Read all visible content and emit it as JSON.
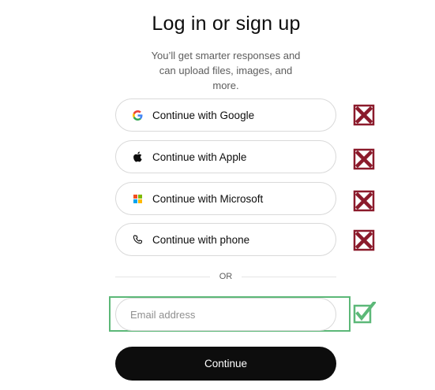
{
  "header": {
    "title": "Log in or sign up",
    "subtitle": "You’ll get smarter responses and can upload files, images, and more."
  },
  "auth_options": [
    {
      "label": "Continue with Google",
      "icon": "google-icon",
      "annotation": "red-x"
    },
    {
      "label": "Continue with Apple",
      "icon": "apple-icon",
      "annotation": "red-x"
    },
    {
      "label": "Continue with Microsoft",
      "icon": "microsoft-icon",
      "annotation": "red-x"
    },
    {
      "label": "Continue with phone",
      "icon": "phone-icon",
      "annotation": "red-x"
    }
  ],
  "divider": {
    "label": "OR"
  },
  "email": {
    "value": "",
    "placeholder": "Email address",
    "annotation": "green-check"
  },
  "continue_button": {
    "label": "Continue"
  },
  "colors": {
    "red_mark": "#8b1a2b",
    "green_mark": "#5cb878",
    "primary_button": "#0d0d0d"
  }
}
